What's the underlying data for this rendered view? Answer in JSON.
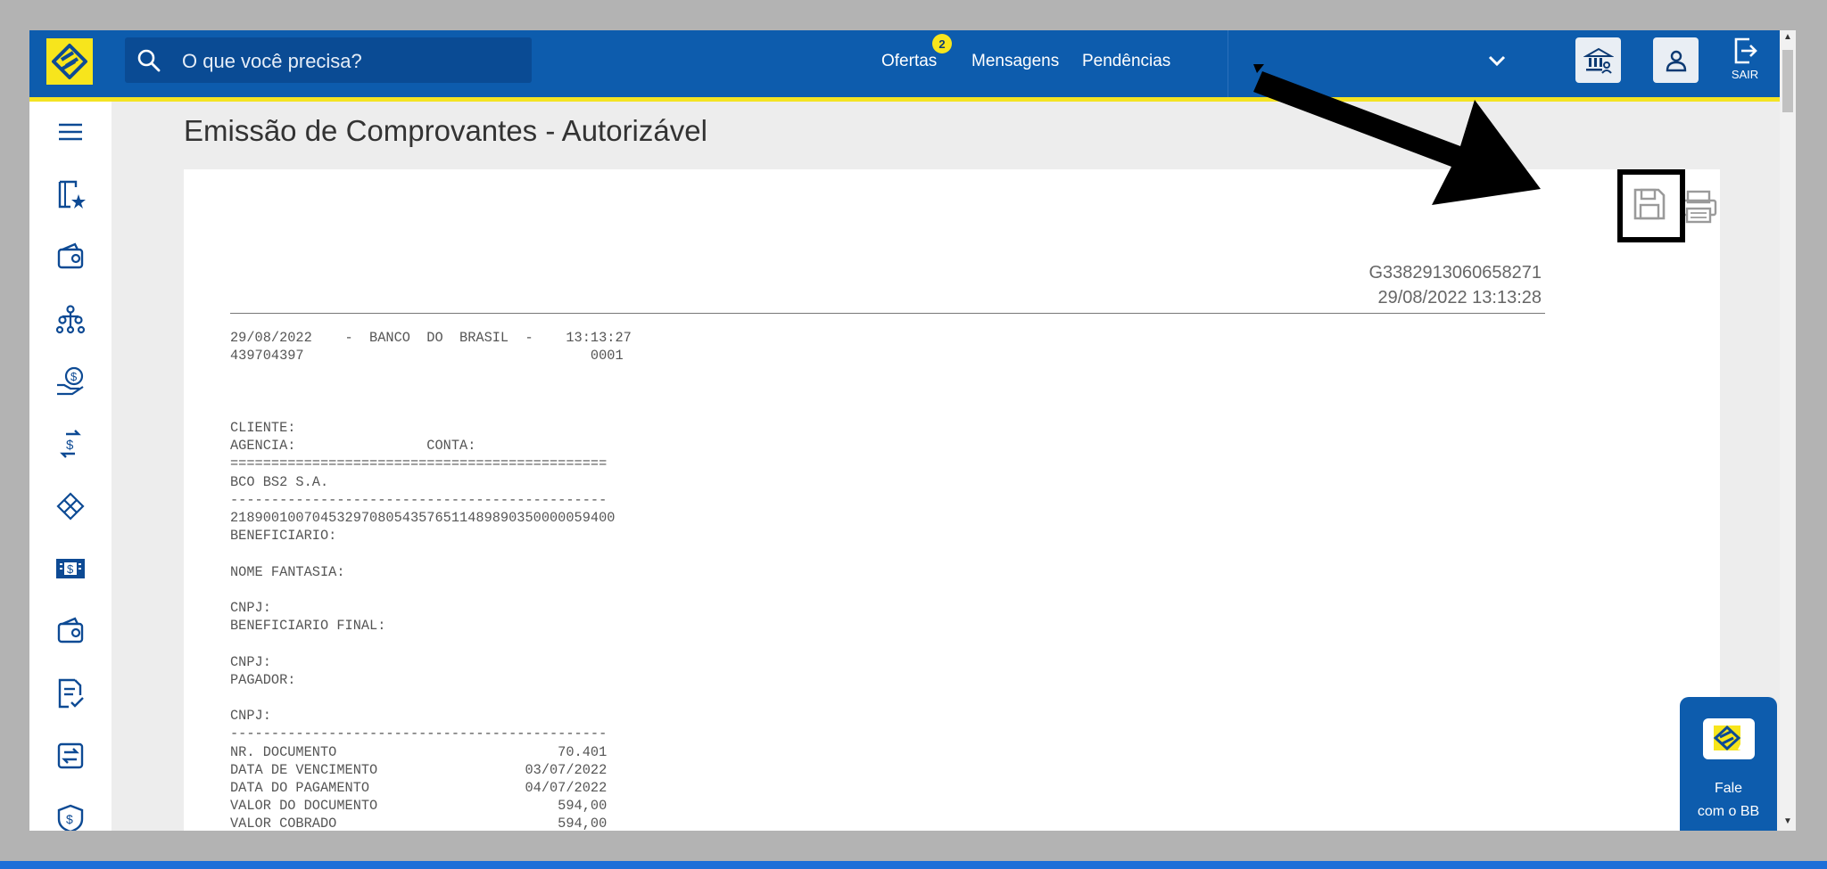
{
  "topbar": {
    "search_placeholder": "O que você precisa?",
    "nav": {
      "ofertas": "Ofertas",
      "ofertas_badge": "2",
      "mensagens": "Mensagens",
      "pendencias": "Pendências"
    },
    "exit_label": "SAIR"
  },
  "page": {
    "title": "Emissão de Comprovantes - Autorizável"
  },
  "receipt": {
    "id": "G3382913060658271",
    "datetime": "29/08/2022 13:13:28",
    "body": "29/08/2022    -  BANCO  DO  BRASIL  -    13:13:27\n439704397                                   0001\n\n\n\nCLIENTE:\nAGENCIA:                CONTA:\n==============================================\nBCO BS2 S.A.\n----------------------------------------------\n21890010070453297080543576511489890350000059400\nBENEFICIARIO:\n\nNOME FANTASIA:\n\nCNPJ:\nBENEFICIARIO FINAL:\n\nCNPJ:\nPAGADOR:\n\nCNPJ:\n----------------------------------------------\nNR. DOCUMENTO                           70.401\nDATA DE VENCIMENTO                  03/07/2022\nDATA DO PAGAMENTO                   04/07/2022\nVALOR DO DOCUMENTO                      594,00\nVALOR COBRADO                           594,00"
  },
  "chat": {
    "label": "Fale\ncom o BB"
  },
  "colors": {
    "brand_blue": "#0d5cad",
    "brand_yellow": "#f7e51c"
  },
  "sidebar_icons": [
    "menu-icon",
    "favorites-icon",
    "wallet-icon",
    "org-chart-icon",
    "money-hand-icon",
    "transfer-icon",
    "pix-icon",
    "cash-icon",
    "wallet-icon",
    "document-check-icon",
    "exchange-icon",
    "shield-money-icon"
  ]
}
